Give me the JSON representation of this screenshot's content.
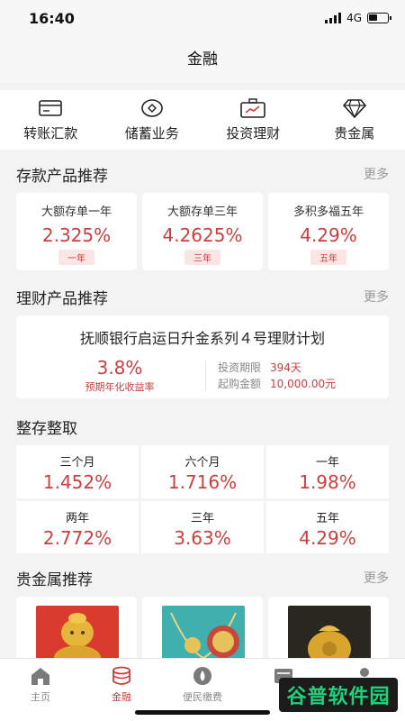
{
  "status_bar": {
    "time": "16:40",
    "network": "4G"
  },
  "nav": {
    "title": "金融"
  },
  "quick_menu": [
    {
      "label": "转账汇款",
      "icon": "card-icon"
    },
    {
      "label": "储蓄业务",
      "icon": "coin-icon"
    },
    {
      "label": "投资理财",
      "icon": "briefcase-chart-icon"
    },
    {
      "label": "贵金属",
      "icon": "diamond-icon"
    }
  ],
  "deposit": {
    "title": "存款产品推荐",
    "more": "更多",
    "products": [
      {
        "name": "大额存单一年",
        "rate": "2.325%",
        "tag": "一年"
      },
      {
        "name": "大额存单三年",
        "rate": "4.2625%",
        "tag": "三年"
      },
      {
        "name": "多积多福五年",
        "rate": "4.29%",
        "tag": "五年"
      }
    ]
  },
  "wealth": {
    "title": "理财产品推荐",
    "more": "更多",
    "product": {
      "name": "抚顺银行启运日升金系列４号理财计划",
      "rate": "3.8%",
      "rate_label": "预期年化收益率",
      "term_label": "投资期限",
      "term_value": "394天",
      "min_label": "起购金额",
      "min_value": "10,000.00元"
    }
  },
  "term_deposit": {
    "title": "整存整取",
    "items": [
      {
        "name": "三个月",
        "rate": "1.452%"
      },
      {
        "name": "六个月",
        "rate": "1.716%"
      },
      {
        "name": "一年",
        "rate": "1.98%"
      },
      {
        "name": "两年",
        "rate": "2.772%"
      },
      {
        "name": "三年",
        "rate": "3.63%"
      },
      {
        "name": "五年",
        "rate": "4.29%"
      }
    ]
  },
  "metal": {
    "title": "贵金属推荐",
    "more": "更多",
    "items": [
      {
        "image": "gold-figurine-image"
      },
      {
        "image": "gold-pendant-image"
      },
      {
        "image": "gold-bag-image"
      }
    ]
  },
  "tab_bar": [
    {
      "label": "主页",
      "icon": "home-icon"
    },
    {
      "label": "金融",
      "icon": "coins-icon"
    },
    {
      "label": "便民缴费",
      "icon": "drop-icon"
    },
    {
      "label": "信",
      "icon": "message-icon"
    },
    {
      "label": "",
      "icon": "user-icon"
    }
  ],
  "watermark": {
    "text": "谷普软件园"
  },
  "colors": {
    "accent": "#c9403f",
    "muted": "#999999",
    "tag_bg": "#fbe6e3"
  }
}
